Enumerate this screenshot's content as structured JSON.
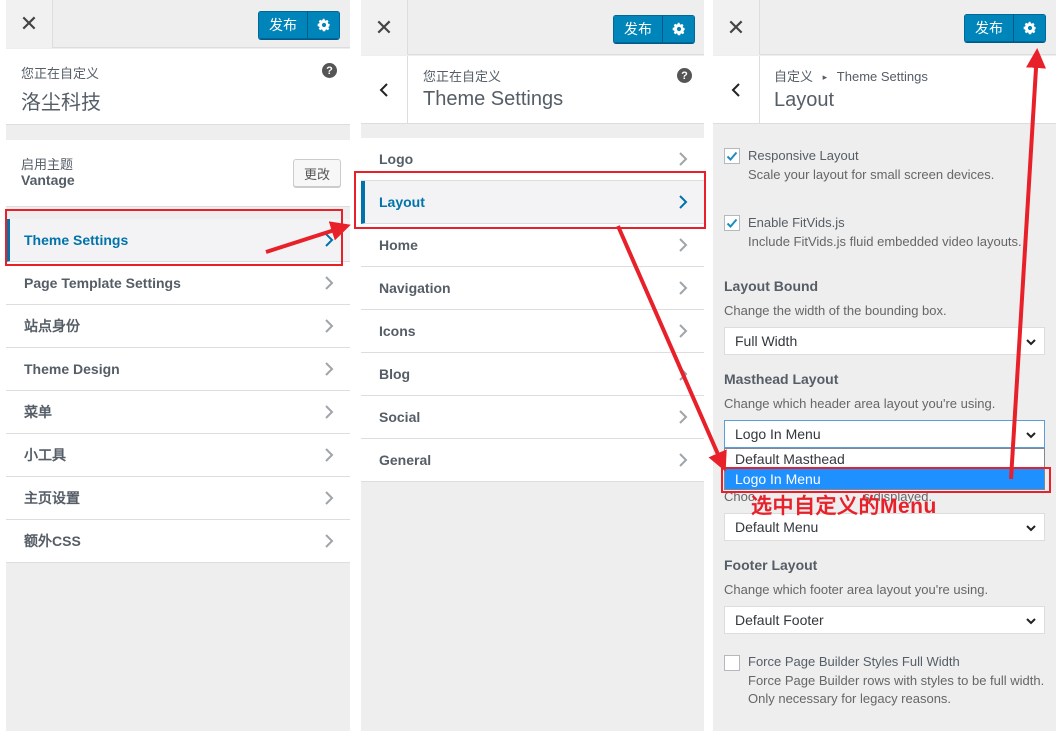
{
  "panel1": {
    "publish_label": "发布",
    "customizing_label": "您正在自定义",
    "site_title": "洛尘科技",
    "active_theme_label": "启用主题",
    "theme_name": "Vantage",
    "change_button": "更改",
    "items": [
      {
        "label": "Theme Settings"
      },
      {
        "label": "Page Template Settings"
      },
      {
        "label": "站点身份"
      },
      {
        "label": "Theme Design"
      },
      {
        "label": "菜单"
      },
      {
        "label": "小工具"
      },
      {
        "label": "主页设置"
      },
      {
        "label": "额外CSS"
      }
    ]
  },
  "panel2": {
    "publish_label": "发布",
    "customizing_label": "您正在自定义",
    "section_title": "Theme Settings",
    "items": [
      {
        "label": "Logo"
      },
      {
        "label": "Layout"
      },
      {
        "label": "Home"
      },
      {
        "label": "Navigation"
      },
      {
        "label": "Icons"
      },
      {
        "label": "Blog"
      },
      {
        "label": "Social"
      },
      {
        "label": "General"
      }
    ]
  },
  "panel3": {
    "publish_label": "发布",
    "breadcrumb_root": "自定义",
    "breadcrumb_sep": "▸",
    "breadcrumb_parent": "Theme Settings",
    "section_title": "Layout",
    "responsive": {
      "label": "Responsive Layout",
      "desc": "Scale your layout for small screen devices.",
      "checked": true
    },
    "fitvids": {
      "label": "Enable FitVids.js",
      "desc": "Include FitVids.js fluid embedded video layouts.",
      "checked": true
    },
    "layout_bound": {
      "title": "Layout Bound",
      "desc": "Change the width of the bounding box.",
      "value": "Full Width"
    },
    "masthead": {
      "title": "Masthead Layout",
      "desc": "Change which header area layout you're using.",
      "value": "Logo In Menu",
      "options": [
        "Default Masthead",
        "Logo In Menu"
      ]
    },
    "menu_desc_visible": "Choo                              s displayed.",
    "menu_layout": {
      "value": "Default Menu"
    },
    "footer": {
      "title": "Footer Layout",
      "desc": "Change which footer area layout you're using.",
      "value": "Default Footer"
    },
    "force_pb": {
      "label": "Force Page Builder Styles Full Width",
      "desc1": "Force Page Builder rows with styles to be full width.",
      "desc2": "Only necessary for legacy reasons.",
      "checked": false
    }
  },
  "annotation": {
    "text": "选中自定义的Menu"
  },
  "colors": {
    "accent": "#0073aa",
    "publish": "#0085ba",
    "annotation_red": "#e8202a",
    "selected_option": "#1e90ff"
  }
}
